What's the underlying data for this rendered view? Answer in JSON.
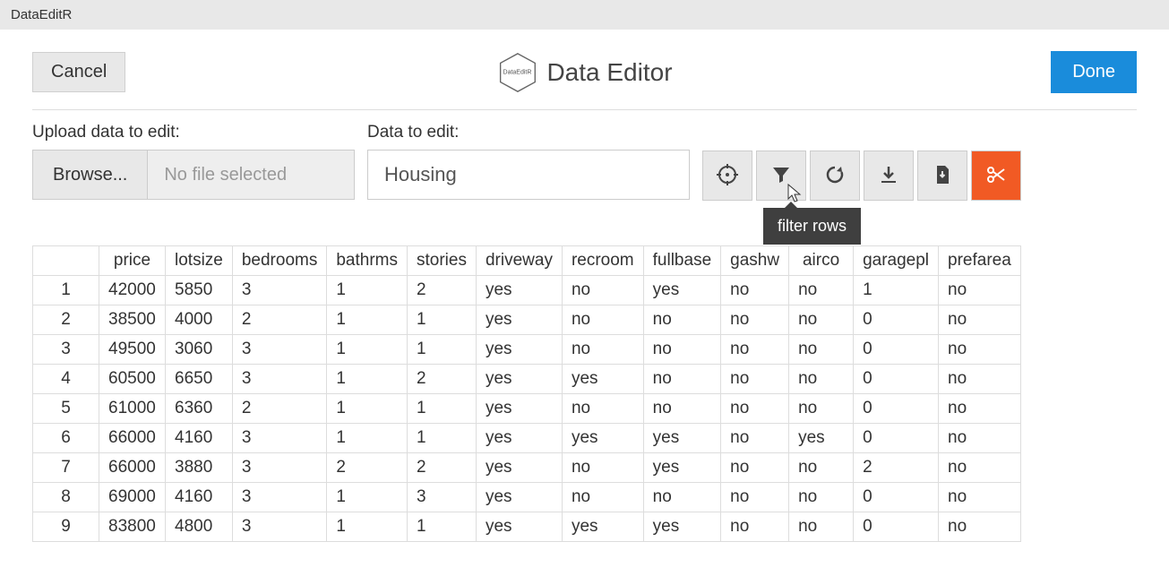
{
  "app_title": "DataEditR",
  "header": {
    "cancel_label": "Cancel",
    "logo_text": "DataEditR",
    "title": "Data Editor",
    "done_label": "Done"
  },
  "upload": {
    "label": "Upload data to edit:",
    "browse_label": "Browse...",
    "status": "No file selected"
  },
  "data_select": {
    "label": "Data to edit:",
    "value": "Housing"
  },
  "tooltip": "filter rows",
  "icons": {
    "target": "target-icon",
    "filter": "filter-icon",
    "refresh": "refresh-icon",
    "export": "export-icon",
    "download": "download-file-icon",
    "cut": "cut-icon"
  },
  "table": {
    "headers": [
      "price",
      "lotsize",
      "bedrooms",
      "bathrms",
      "stories",
      "driveway",
      "recroom",
      "fullbase",
      "gashw",
      "airco",
      "garagepl",
      "prefarea"
    ],
    "rows": [
      {
        "n": 1,
        "cells": [
          "42000",
          "5850",
          "3",
          "1",
          "2",
          "yes",
          "no",
          "yes",
          "no",
          "no",
          "1",
          "no"
        ]
      },
      {
        "n": 2,
        "cells": [
          "38500",
          "4000",
          "2",
          "1",
          "1",
          "yes",
          "no",
          "no",
          "no",
          "no",
          "0",
          "no"
        ]
      },
      {
        "n": 3,
        "cells": [
          "49500",
          "3060",
          "3",
          "1",
          "1",
          "yes",
          "no",
          "no",
          "no",
          "no",
          "0",
          "no"
        ]
      },
      {
        "n": 4,
        "cells": [
          "60500",
          "6650",
          "3",
          "1",
          "2",
          "yes",
          "yes",
          "no",
          "no",
          "no",
          "0",
          "no"
        ]
      },
      {
        "n": 5,
        "cells": [
          "61000",
          "6360",
          "2",
          "1",
          "1",
          "yes",
          "no",
          "no",
          "no",
          "no",
          "0",
          "no"
        ]
      },
      {
        "n": 6,
        "cells": [
          "66000",
          "4160",
          "3",
          "1",
          "1",
          "yes",
          "yes",
          "yes",
          "no",
          "yes",
          "0",
          "no"
        ]
      },
      {
        "n": 7,
        "cells": [
          "66000",
          "3880",
          "3",
          "2",
          "2",
          "yes",
          "no",
          "yes",
          "no",
          "no",
          "2",
          "no"
        ]
      },
      {
        "n": 8,
        "cells": [
          "69000",
          "4160",
          "3",
          "1",
          "3",
          "yes",
          "no",
          "no",
          "no",
          "no",
          "0",
          "no"
        ]
      },
      {
        "n": 9,
        "cells": [
          "83800",
          "4800",
          "3",
          "1",
          "1",
          "yes",
          "yes",
          "yes",
          "no",
          "no",
          "0",
          "no"
        ]
      }
    ]
  }
}
